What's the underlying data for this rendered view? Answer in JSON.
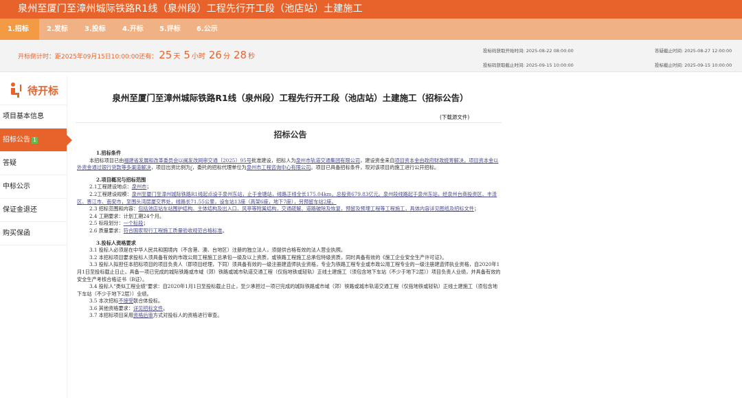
{
  "page_title": "泉州至厦门至漳州城际铁路R1线（泉州段）工程先行开工段（池店站）土建施工",
  "steps": [
    "1.招标",
    "2.发标",
    "3.投标",
    "4.开标",
    "5.评标",
    "6.公示"
  ],
  "countdown": {
    "prefix": "开标倒计时：距2025年09月15日10:00:00还有：",
    "days": "25",
    "days_unit": "天",
    "hours": "5",
    "hours_unit": "小时",
    "minutes": "26",
    "minutes_unit": "分",
    "seconds": "28",
    "seconds_unit": "秒"
  },
  "times": {
    "code_start": "投标码获取开始时间: 2025-08-22 08:00:00",
    "code_end": "投标码获取截止时间: 2025-09-15 10:00:00",
    "qa_end": "答疑截止时间: 2025-08-27 12:00:00",
    "bid_end": "投标截止时间: 2025-09-15 10:00:00"
  },
  "sidebar": {
    "status": "待开标",
    "items": [
      {
        "label": "项目基本信息"
      },
      {
        "label": "招标公告",
        "badge": "1"
      },
      {
        "label": "答疑"
      },
      {
        "label": "中标公示"
      },
      {
        "label": "保证金退还"
      },
      {
        "label": "购买保函"
      }
    ]
  },
  "doc": {
    "title": "泉州至厦门至漳州城际铁路R1线（泉州段）工程先行开工段（池店站）土建施工（招标公告）",
    "download": "(下载源文件)",
    "notice": "招标公告",
    "s1": "1.招标条件",
    "s1_a": "本招标项目已由",
    "s1_b": "福建省发展和改革委员会以闽发改网审交通〔2025〕95号",
    "s1_c": "批准建设，招标人为",
    "s1_d": "泉州市轨道交通集团有限公司",
    "s1_e": "，建设资金来自",
    "s1_f": "项目资本金由政府财政统筹解决，项目资本金以外资金通过银行贷款等多渠道解决",
    "s1_g": "，项目出资比例为",
    "s1_h": "/",
    "s1_i": "，委托的招标代理单位为",
    "s1_j": "泉州市工程咨询中心有限公司",
    "s1_k": "。项目已具备招标条件，现对该项目的施工进行公开招标。",
    "s2": "2.项目概况与招标范围",
    "s2_1a": "2.1工程建设地点：",
    "s2_1b": "泉州市",
    "s2_1c": "；",
    "s2_2a": "2.2工程建设规模：",
    "s2_2b": "泉州至厦门至漳州城际铁路R1线起点设于泉州东站，止于金塘站，线路正线全长175.04km，总投资679.83亿元。泉州段线路起于泉州东站，经泉州台商投资区、丰泽区、晋江市、南安市，至围头湾层厦交界处，线路长71.55公里，设车站13座（高架6座，地下7座），另预留车站2座。",
    "s2_3a": "2.3 招标范围和内容：",
    "s2_3b": "包括池店站车站围护结构、主体结构及出入口、风亭等附属结构，交通疏解、道路破除及恢复，预留及预埋工程等工程施工，具体内容详见图纸及招标文件",
    "s2_3c": "；",
    "s2_4": "2.4 工期要求：计划工期24个月。",
    "s2_5a": "2.5 标段划分：",
    "s2_5b": "一个标段",
    "s2_5c": "；",
    "s2_6a": "2.6 质量要求：",
    "s2_6b": "符合国家现行工程施工质量验收规范合格标准",
    "s2_6c": "。",
    "s3": "3.投标人资格要求",
    "s3_1": "3.1 投标人必须是在中华人民共和国境内（不含港、澳、台地区）注册的独立法人，须提供合格有效的法人营业执照。",
    "s3_2": "3.2 本招标项目要求投标人须具备有效的市政公用工程施工总承包一级及以上资质，或铁路工程施工总承包特级资质，同时具备有效的《施工企业安全生产许可证》。",
    "s3_3": "3.3 投标人拟担任本招标项目的项目负责人（即项目经理，下同）须具备有效的一级注册建造师执业资格，专业为铁路工程专业或市政公用工程专业的一级注册建造师执业资格，自2020年1月1日至投标截止日止，具备一项已完成的城际铁路或市域（郊）铁路或城市轨道交通工程（仅指地铁或轻轨）正线土建施工（须包含地下车站（不少于地下2层））项目负责人业绩，并具备有效的安全生产考核合格证书（B证）。",
    "s3_4": "3.4 投标人\"类似工程业绩\"要求：自2020年1月1日至投标截止日止，至少承担过一项已完成的城际铁路或市域（郊）铁路或城市轨道交通工程（仅指地铁或轻轨）正线土建施工（须包含地下车站（不少于地下2层））业绩。",
    "s3_5a": "3.5 本次招标",
    "s3_5b": "不接受",
    "s3_5c": "联合体投标。",
    "s3_6a": "3.6 其他资格要求：",
    "s3_6b": "详见招标文件",
    "s3_6c": "。",
    "s3_7a": "3.7 本招标项目采用",
    "s3_7b": "资格后审",
    "s3_7c": "方式对投标人的资格进行审查。"
  },
  "colors": {
    "brand": "#e8632b",
    "steps_bg": "#f0b285",
    "step_active": "#f29a44",
    "badge": "#6bb84e"
  }
}
